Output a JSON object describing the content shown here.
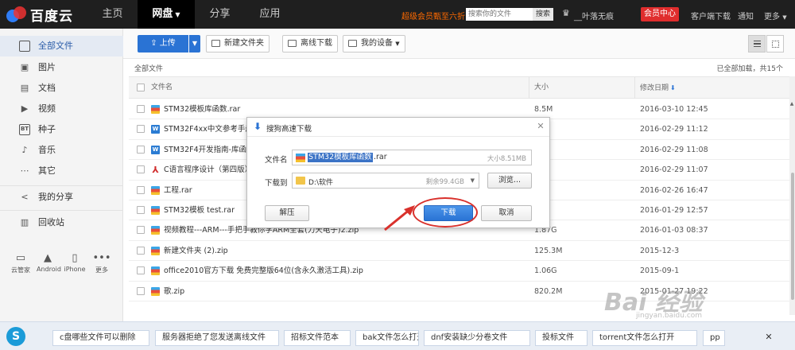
{
  "app": {
    "logo_text": "百度云"
  },
  "nav": {
    "tabs": [
      "主页",
      "网盘",
      "分享",
      "应用"
    ],
    "active_index": 1
  },
  "topbar": {
    "promo": "超级会员甄至六折",
    "search_placeholder": "搜索你的文件",
    "search_button": "搜索",
    "username": "__叶落无痕",
    "vip_button": "会员中心",
    "client_download": "客户端下载",
    "notifications": "通知",
    "more": "更多"
  },
  "sidebar": {
    "items": [
      {
        "label": "全部文件",
        "icon": "file-list-icon",
        "glyph": "□"
      },
      {
        "label": "图片",
        "icon": "image-icon",
        "glyph": "▣"
      },
      {
        "label": "文档",
        "icon": "document-icon",
        "glyph": "▤"
      },
      {
        "label": "视频",
        "icon": "video-icon",
        "glyph": "▶"
      },
      {
        "label": "种子",
        "icon": "torrent-icon",
        "glyph": "BT"
      },
      {
        "label": "音乐",
        "icon": "music-icon",
        "glyph": "♪"
      },
      {
        "label": "其它",
        "icon": "other-icon",
        "glyph": "⋯"
      }
    ],
    "share": "我的分享",
    "recycle": "回收站",
    "devices": [
      "云管家",
      "Android",
      "iPhone",
      "更多"
    ]
  },
  "toolbar": {
    "upload": "上传",
    "new_folder": "新建文件夹",
    "offline_download": "离线下载",
    "my_devices": "我的设备"
  },
  "list": {
    "breadcrumb": "全部文件",
    "loaded_info": "已全部加载，共15个",
    "col_name": "文件名",
    "col_size": "大小",
    "col_date": "修改日期",
    "rows": [
      {
        "type": "rar",
        "name": "STM32模板库函数.rar",
        "size": "8.5M",
        "date": "2016-03-10 12:45"
      },
      {
        "type": "doc",
        "name": "STM32F4xx中文参考手册.c",
        "size": "",
        "date": "2016-02-29 11:12"
      },
      {
        "type": "doc",
        "name": "STM32F4开发指南-库函数版",
        "size": "M",
        "date": "2016-02-29 11:08"
      },
      {
        "type": "pdf",
        "name": "C语言程序设计（第四版）",
        "size": "",
        "date": "2016-02-29 11:07"
      },
      {
        "type": "rar",
        "name": "工程.rar",
        "size": "",
        "date": "2016-02-26 16:47"
      },
      {
        "type": "rar",
        "name": "STM32模板 test.rar",
        "size": "B",
        "date": "2016-01-29 12:57"
      },
      {
        "type": "zip",
        "name": "视频教程---ARM---手把手教你学ARM全套(力天电子)2.zip",
        "size": "1.87G",
        "date": "2016-01-03 08:37"
      },
      {
        "type": "zip",
        "name": "新建文件夹 (2).zip",
        "size": "125.3M",
        "date": "2015-12-3"
      },
      {
        "type": "zip",
        "name": "office2010官方下载 免费完整版64位(含永久激活工具).zip",
        "size": "1.06G",
        "date": "2015-09-1"
      },
      {
        "type": "zip",
        "name": "歌.zip",
        "size": "820.2M",
        "date": "2015-01-27 19:22"
      }
    ]
  },
  "dialog": {
    "title": "搜狗高速下载",
    "filename_label": "文件名",
    "filename_selected": "STM32模板库函数",
    "filename_ext": ".rar",
    "filesize": "大小8.51MB",
    "saveto_label": "下载到",
    "path": "D:\\软件",
    "free_space": "剩余99.4GB",
    "browse": "浏览...",
    "extract": "解压",
    "download": "下载",
    "cancel": "取消"
  },
  "bottombar": {
    "chips": [
      "c盘哪些文件可以删除",
      "服务器拒绝了您发送离线文件",
      "招标文件范本",
      "bak文件怎么打开",
      "dnf安装缺少分卷文件",
      "投标文件",
      "torrent文件怎么打开",
      "pp"
    ]
  },
  "watermark": {
    "text": "Bai 经验",
    "sub": "jingyan.baidu.com"
  },
  "colors": {
    "topbar": "#1f1f1f",
    "accent": "#2a73d4",
    "vip": "#e02d2d",
    "promo": "#ff6a00",
    "annotation": "#d9312c"
  }
}
